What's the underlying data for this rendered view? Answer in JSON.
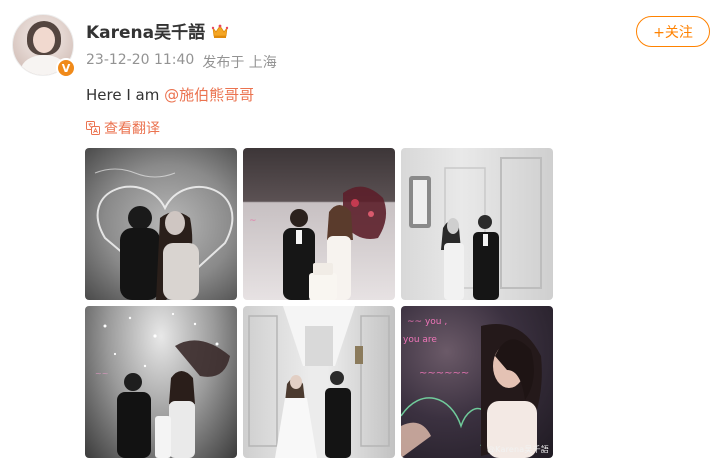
{
  "user": {
    "name": "Karena吴千語",
    "verified_mark": "V",
    "crown_icon": "crown-icon"
  },
  "meta": {
    "timestamp": "23-12-20 11:40",
    "location": "发布于 上海"
  },
  "follow": {
    "label": "+关注"
  },
  "post": {
    "text_prefix": "Here I am ",
    "mention": "@施伯熊哥哥"
  },
  "translate": {
    "label": "查看翻译",
    "icon": "translate-icon"
  },
  "photos": [
    {
      "id": "photo-1"
    },
    {
      "id": "photo-2"
    },
    {
      "id": "photo-3"
    },
    {
      "id": "photo-4"
    },
    {
      "id": "photo-5"
    },
    {
      "id": "photo-6",
      "watermark": "@Karena吴千語"
    }
  ],
  "colors": {
    "accent": "#ff8200",
    "link": "#eb7350",
    "meta": "#939393",
    "text": "#333333"
  }
}
